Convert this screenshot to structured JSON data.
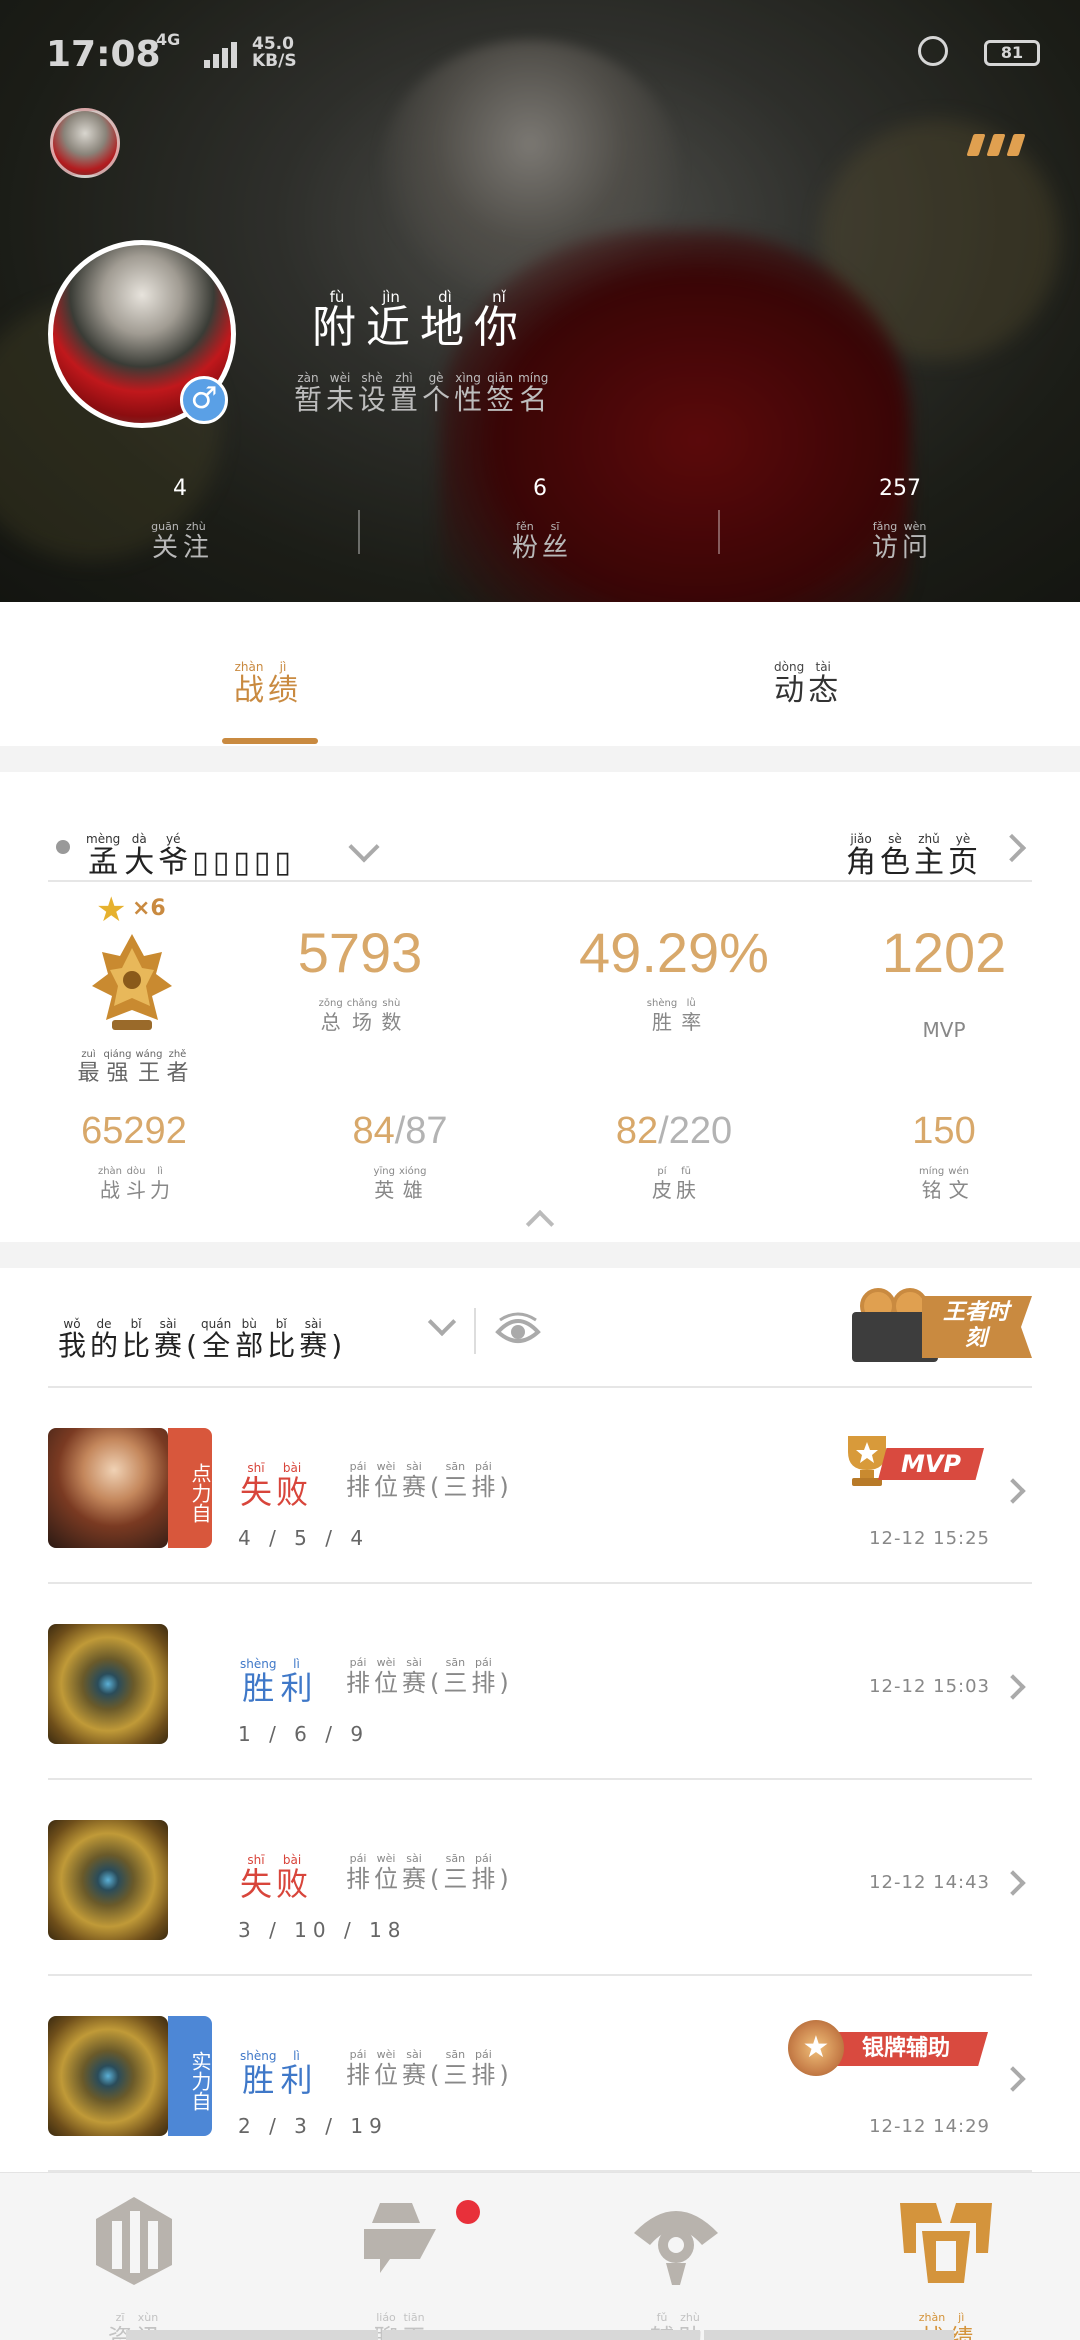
{
  "status_bar": {
    "time": "17:08",
    "network": "4G",
    "signal_label": "4G",
    "speed": "45.0",
    "speed_unit": "KB/S",
    "battery": "81"
  },
  "profile": {
    "nickname": [
      {
        "py": "fù",
        "ch": "附"
      },
      {
        "py": "jìn",
        "ch": "近"
      },
      {
        "py": "dì",
        "ch": "地"
      },
      {
        "py": "nǐ",
        "ch": "你"
      }
    ],
    "signature": [
      {
        "py": "zàn",
        "ch": "暂"
      },
      {
        "py": "wèi",
        "ch": "未"
      },
      {
        "py": "shè",
        "ch": "设"
      },
      {
        "py": "zhì",
        "ch": "置"
      },
      {
        "py": "gè",
        "ch": "个"
      },
      {
        "py": "xìng",
        "ch": "性"
      },
      {
        "py": "qiān",
        "ch": "签"
      },
      {
        "py": "míng",
        "ch": "名"
      }
    ],
    "gender_symbol": "♂",
    "stats": [
      {
        "value": "4",
        "label": [
          {
            "py": "guān",
            "ch": "关"
          },
          {
            "py": "zhù",
            "ch": "注"
          }
        ]
      },
      {
        "value": "6",
        "label": [
          {
            "py": "fěn",
            "ch": "粉"
          },
          {
            "py": "sī",
            "ch": "丝"
          }
        ]
      },
      {
        "value": "257",
        "label": [
          {
            "py": "fǎng",
            "ch": "访"
          },
          {
            "py": "wèn",
            "ch": "问"
          }
        ]
      }
    ]
  },
  "tabs": [
    {
      "label": [
        {
          "py": "zhàn",
          "ch": "战"
        },
        {
          "py": "jì",
          "ch": "绩"
        }
      ],
      "active": true
    },
    {
      "label": [
        {
          "py": "dòng",
          "ch": "动"
        },
        {
          "py": "tài",
          "ch": "态"
        }
      ],
      "active": false
    }
  ],
  "role": {
    "name": [
      {
        "py": "mèng",
        "ch": "孟"
      },
      {
        "py": "dà",
        "ch": "大"
      },
      {
        "py": "yé",
        "ch": "爷"
      },
      {
        "py": "",
        "ch": "▯"
      },
      {
        "py": "",
        "ch": "▯"
      },
      {
        "py": "",
        "ch": "▯"
      },
      {
        "py": "",
        "ch": "▯"
      },
      {
        "py": "",
        "ch": "▯"
      }
    ],
    "right_label": [
      {
        "py": "jiǎo",
        "ch": "角"
      },
      {
        "py": "sè",
        "ch": "色"
      },
      {
        "py": "zhǔ",
        "ch": "主"
      },
      {
        "py": "yè",
        "ch": "页"
      }
    ]
  },
  "rank": {
    "star": "★",
    "multiplier": "×6",
    "name": [
      {
        "py": "zuì",
        "ch": "最"
      },
      {
        "py": "qiáng",
        "ch": "强"
      },
      {
        "py": "wáng",
        "ch": "王"
      },
      {
        "py": "zhě",
        "ch": "者"
      }
    ]
  },
  "stats_main": [
    {
      "value": "5793",
      "label": [
        {
          "py": "zǒng",
          "ch": "总"
        },
        {
          "py": "chǎng",
          "ch": "场"
        },
        {
          "py": "shù",
          "ch": "数"
        }
      ]
    },
    {
      "value": "49.29%",
      "label": [
        {
          "py": "shèng",
          "ch": "胜"
        },
        {
          "py": "lǜ",
          "ch": "率"
        }
      ]
    },
    {
      "value": "1202",
      "label": [
        {
          "py": "",
          "ch": "MVP"
        }
      ]
    }
  ],
  "stats_sub": [
    {
      "value": "65292",
      "dim": "",
      "label": [
        {
          "py": "zhàn",
          "ch": "战"
        },
        {
          "py": "dòu",
          "ch": "斗"
        },
        {
          "py": "lì",
          "ch": "力"
        }
      ]
    },
    {
      "value": "84",
      "dim": "/87",
      "label": [
        {
          "py": "yīng",
          "ch": "英"
        },
        {
          "py": "xióng",
          "ch": "雄"
        }
      ]
    },
    {
      "value": "82",
      "dim": "/220",
      "label": [
        {
          "py": "pí",
          "ch": "皮"
        },
        {
          "py": "fū",
          "ch": "肤"
        }
      ]
    },
    {
      "value": "150",
      "dim": "",
      "label": [
        {
          "py": "míng",
          "ch": "铭"
        },
        {
          "py": "wén",
          "ch": "文"
        }
      ]
    }
  ],
  "matches_header": {
    "title": [
      {
        "py": "wǒ",
        "ch": "我"
      },
      {
        "py": "de",
        "ch": "的"
      },
      {
        "py": "bǐ",
        "ch": "比"
      },
      {
        "py": "sài",
        "ch": "赛"
      },
      {
        "py": "",
        "ch": "("
      },
      {
        "py": "quán",
        "ch": "全"
      },
      {
        "py": "bù",
        "ch": "部"
      },
      {
        "py": "bǐ",
        "ch": "比"
      },
      {
        "py": "sài",
        "ch": "赛"
      },
      {
        "py": "",
        "ch": ")"
      }
    ],
    "king_moment": "王者时刻"
  },
  "matches": [
    {
      "hero": "f",
      "tag": "点力自",
      "tag_color": "red",
      "result": [
        {
          "py": "shī",
          "ch": "失"
        },
        {
          "py": "bài",
          "ch": "败"
        }
      ],
      "win": false,
      "mode": [
        {
          "py": "pái",
          "ch": "排"
        },
        {
          "py": "wèi",
          "ch": "位"
        },
        {
          "py": "sài",
          "ch": "赛"
        },
        {
          "py": "",
          "ch": "("
        },
        {
          "py": "sān",
          "ch": "三"
        },
        {
          "py": "pái",
          "ch": "排"
        },
        {
          "py": "",
          "ch": ")"
        }
      ],
      "kda": "4 / 5 / 4",
      "time": "12-12  15:25",
      "badge": "mvp",
      "badge_text": "MVP"
    },
    {
      "hero": "m",
      "tag": "",
      "tag_color": "",
      "result": [
        {
          "py": "shèng",
          "ch": "胜"
        },
        {
          "py": "lì",
          "ch": "利"
        }
      ],
      "win": true,
      "mode": [
        {
          "py": "pái",
          "ch": "排"
        },
        {
          "py": "wèi",
          "ch": "位"
        },
        {
          "py": "sài",
          "ch": "赛"
        },
        {
          "py": "",
          "ch": "("
        },
        {
          "py": "sān",
          "ch": "三"
        },
        {
          "py": "pái",
          "ch": "排"
        },
        {
          "py": "",
          "ch": ")"
        }
      ],
      "kda": "1 / 6 / 9",
      "time": "12-12  15:03",
      "badge": "",
      "badge_text": ""
    },
    {
      "hero": "m",
      "tag": "",
      "tag_color": "",
      "result": [
        {
          "py": "shī",
          "ch": "失"
        },
        {
          "py": "bài",
          "ch": "败"
        }
      ],
      "win": false,
      "mode": [
        {
          "py": "pái",
          "ch": "排"
        },
        {
          "py": "wèi",
          "ch": "位"
        },
        {
          "py": "sài",
          "ch": "赛"
        },
        {
          "py": "",
          "ch": "("
        },
        {
          "py": "sān",
          "ch": "三"
        },
        {
          "py": "pái",
          "ch": "排"
        },
        {
          "py": "",
          "ch": ")"
        }
      ],
      "kda": "3 / 10 / 18",
      "time": "12-12  14:43",
      "badge": "",
      "badge_text": ""
    },
    {
      "hero": "m",
      "tag": "实力自",
      "tag_color": "blue",
      "result": [
        {
          "py": "shèng",
          "ch": "胜"
        },
        {
          "py": "lì",
          "ch": "利"
        }
      ],
      "win": true,
      "mode": [
        {
          "py": "pái",
          "ch": "排"
        },
        {
          "py": "wèi",
          "ch": "位"
        },
        {
          "py": "sài",
          "ch": "赛"
        },
        {
          "py": "",
          "ch": "("
        },
        {
          "py": "sān",
          "ch": "三"
        },
        {
          "py": "pái",
          "ch": "排"
        },
        {
          "py": "",
          "ch": ")"
        }
      ],
      "kda": "2 / 3 / 19",
      "time": "12-12  14:29",
      "badge": "silver",
      "badge_text": "银牌辅助"
    }
  ],
  "bottom_nav": [
    {
      "label": [
        {
          "py": "zī",
          "ch": "资"
        },
        {
          "py": "xùn",
          "ch": "讯"
        }
      ],
      "active": false,
      "icon": "news-icon"
    },
    {
      "label": [
        {
          "py": "liáo",
          "ch": "聊"
        },
        {
          "py": "tiān",
          "ch": "天"
        }
      ],
      "active": false,
      "icon": "chat-icon"
    },
    {
      "label": [
        {
          "py": "fǔ",
          "ch": "辅"
        },
        {
          "py": "zhù",
          "ch": "助"
        }
      ],
      "active": false,
      "icon": "assist-icon"
    },
    {
      "label": [
        {
          "py": "zhàn",
          "ch": "战"
        },
        {
          "py": "jì",
          "ch": "绩"
        }
      ],
      "active": true,
      "icon": "record-icon"
    }
  ]
}
